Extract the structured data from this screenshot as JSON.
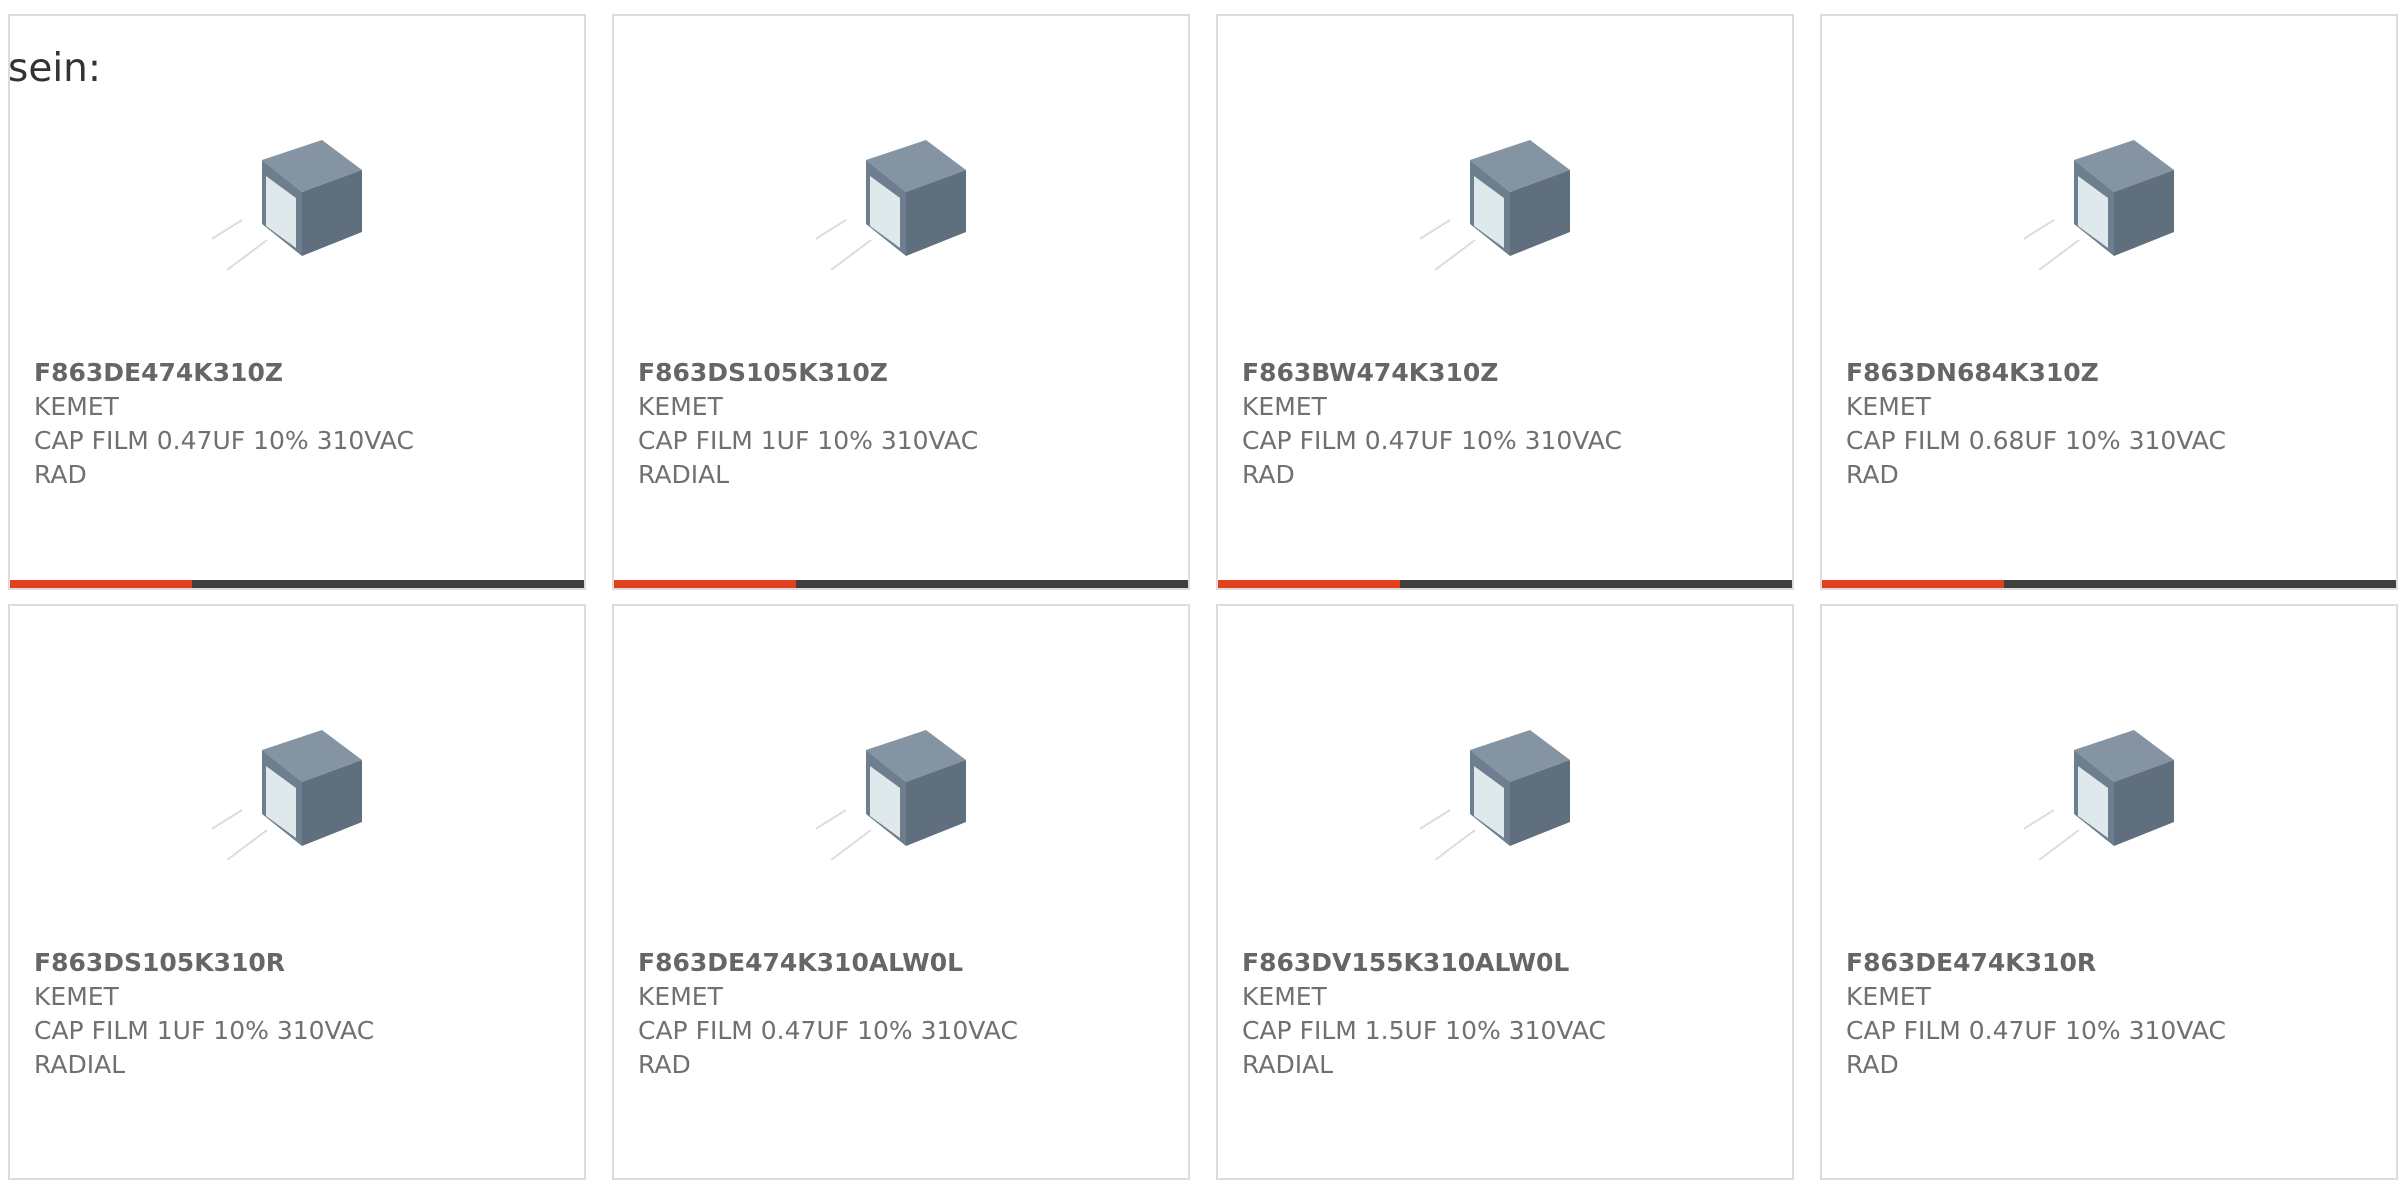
{
  "intro_text": "sein:",
  "colors": {
    "accent": "#e2401c",
    "bar_dark": "#3f3f3f",
    "capacitor_body": "#6d7f8e"
  },
  "products": [
    {
      "part_number": "F863DE474K310Z",
      "manufacturer": "KEMET",
      "description": "CAP FILM 0.47UF 10% 310VAC",
      "package": "RAD"
    },
    {
      "part_number": "F863DS105K310Z",
      "manufacturer": "KEMET",
      "description": "CAP FILM 1UF 10% 310VAC",
      "package": "RADIAL"
    },
    {
      "part_number": "F863BW474K310Z",
      "manufacturer": "KEMET",
      "description": "CAP FILM 0.47UF 10% 310VAC",
      "package": "RAD"
    },
    {
      "part_number": "F863DN684K310Z",
      "manufacturer": "KEMET",
      "description": "CAP FILM 0.68UF 10% 310VAC",
      "package": "RAD"
    },
    {
      "part_number": "F863DS105K310R",
      "manufacturer": "KEMET",
      "description": "CAP FILM 1UF 10% 310VAC",
      "package": "RADIAL"
    },
    {
      "part_number": "F863DE474K310ALW0L",
      "manufacturer": "KEMET",
      "description": "CAP FILM 0.47UF 10% 310VAC",
      "package": "RAD"
    },
    {
      "part_number": "F863DV155K310ALW0L",
      "manufacturer": "KEMET",
      "description": "CAP FILM 1.5UF 10% 310VAC",
      "package": "RADIAL"
    },
    {
      "part_number": "F863DE474K310R",
      "manufacturer": "KEMET",
      "description": "CAP FILM 0.47UF 10% 310VAC",
      "package": "RAD"
    }
  ]
}
